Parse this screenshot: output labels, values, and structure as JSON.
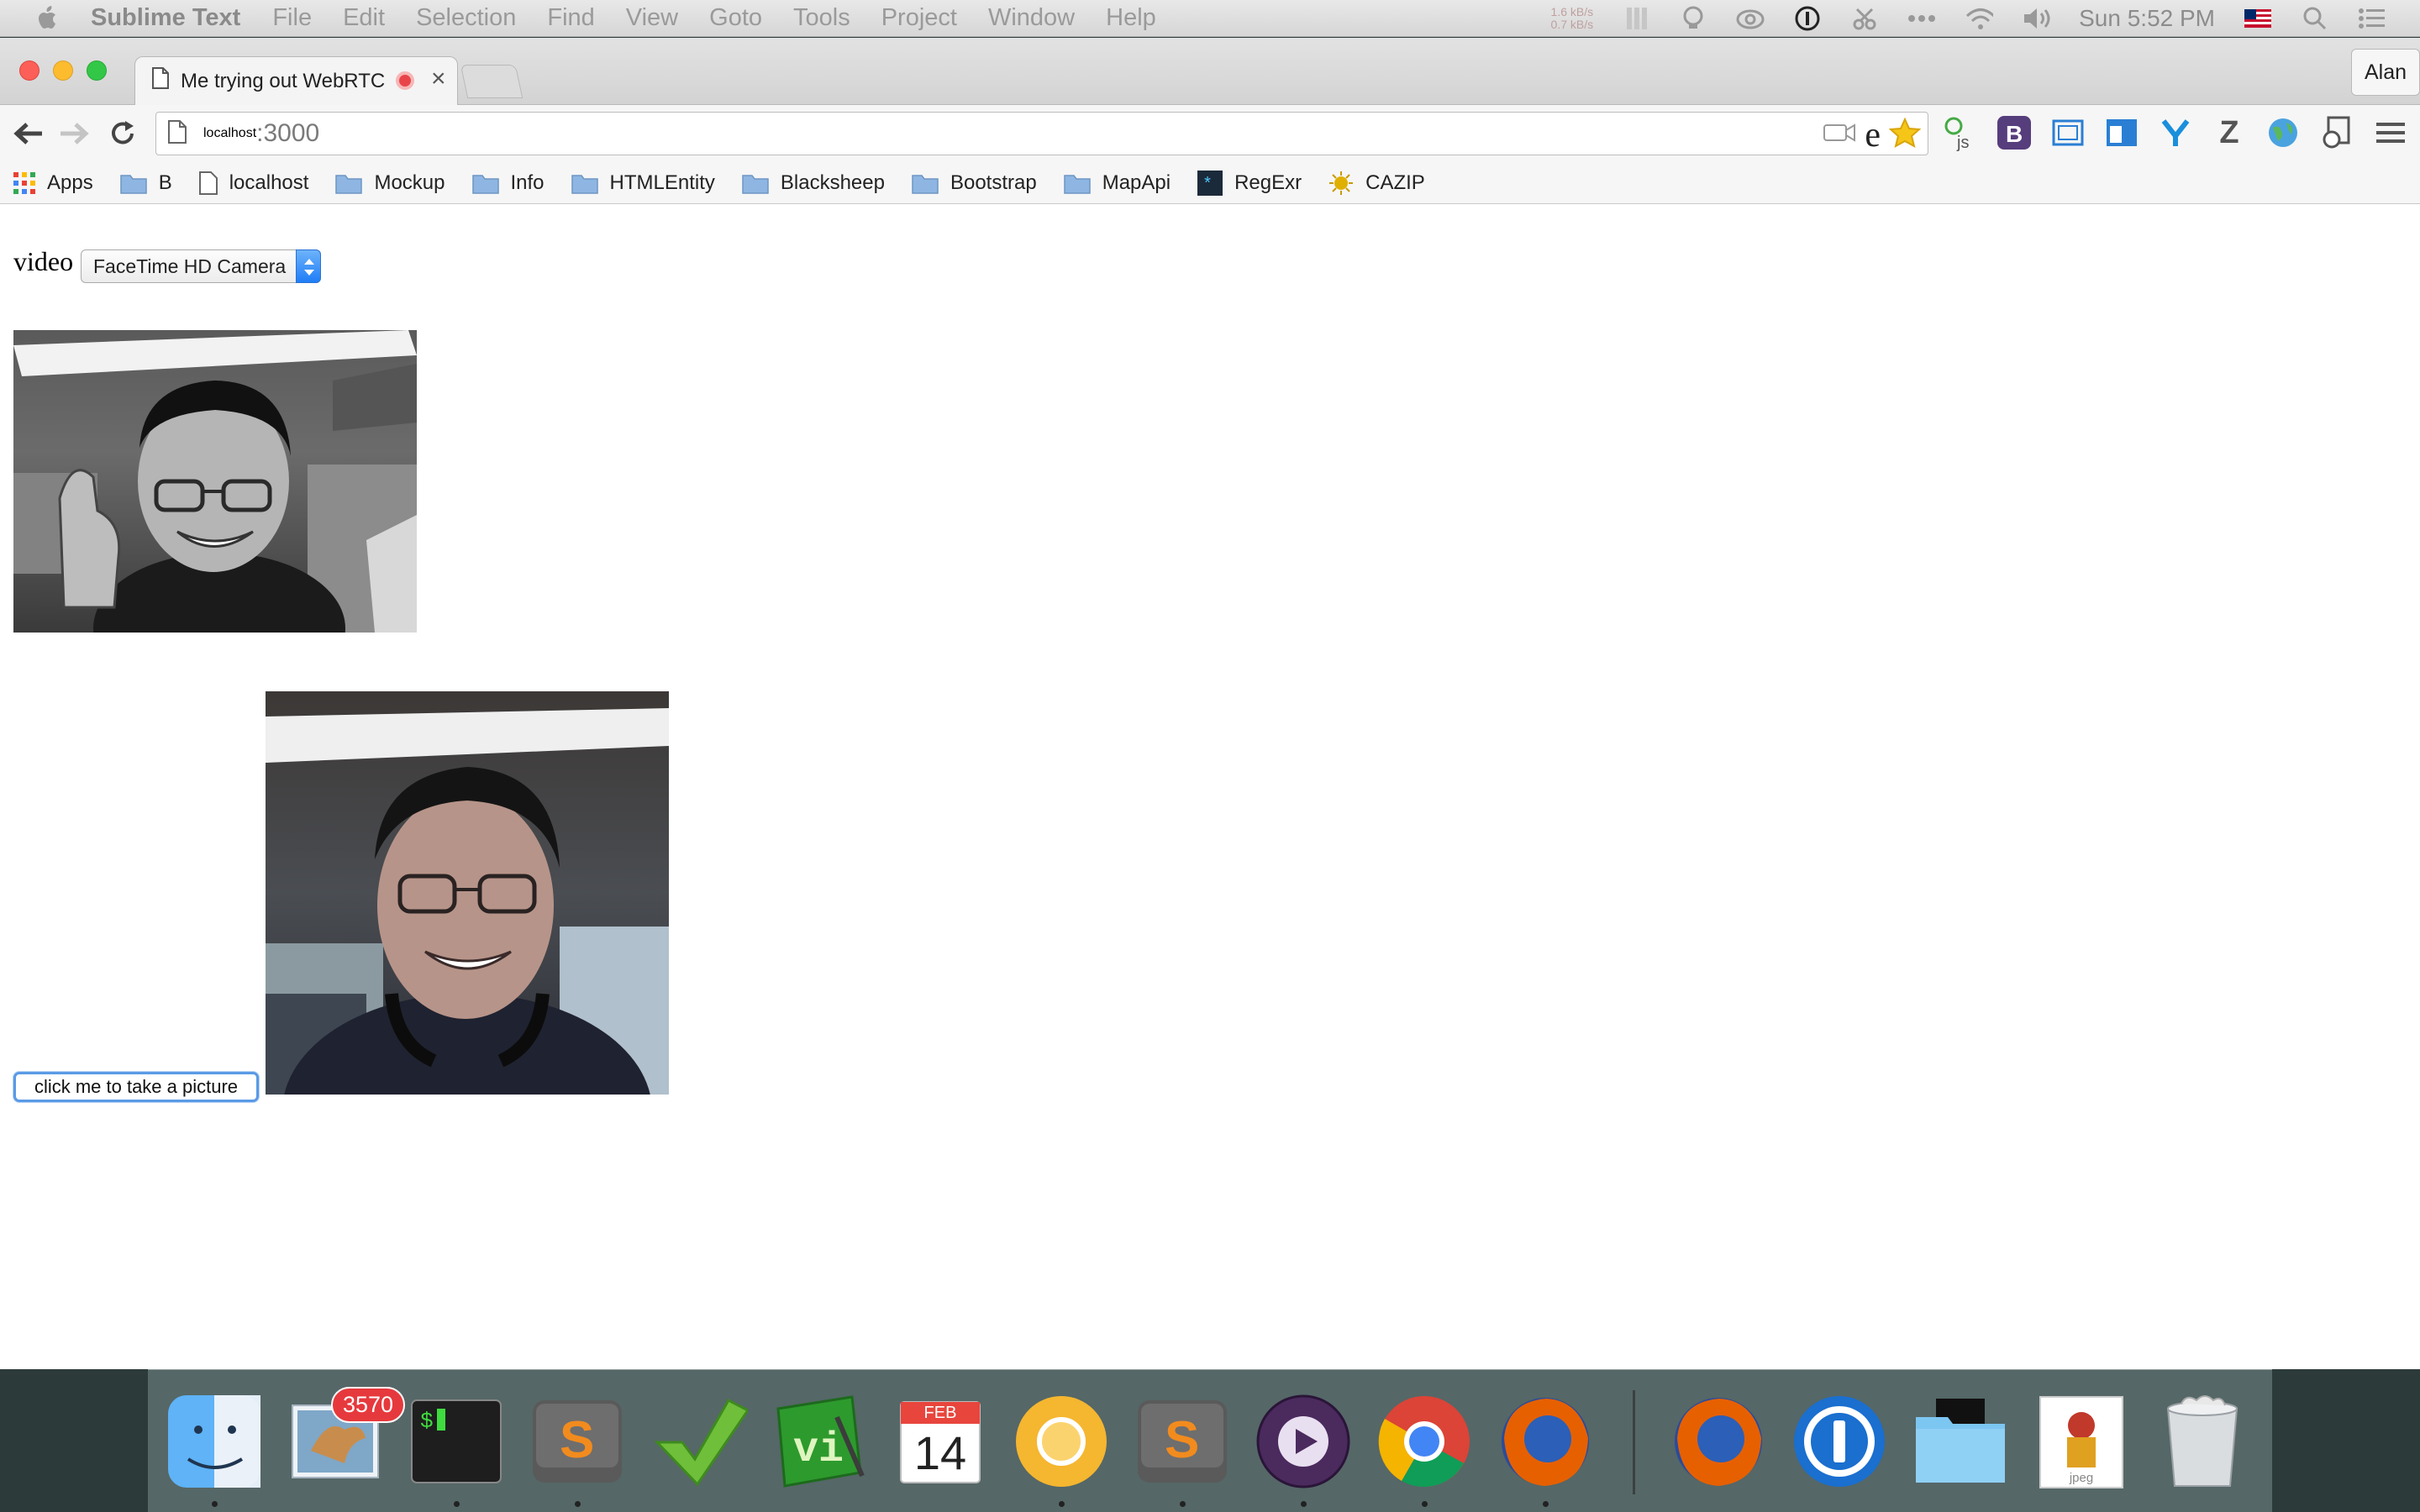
{
  "menubar": {
    "app_name": "Sublime Text",
    "menus": [
      "File",
      "Edit",
      "Selection",
      "Find",
      "View",
      "Goto",
      "Tools",
      "Project",
      "Window",
      "Help"
    ],
    "net_up": "1.6 kB/s",
    "net_down": "0.7 kB/s",
    "clock": "Sun 5:52 PM"
  },
  "browser": {
    "tab_title": "Me trying out WebRTC",
    "profile_name": "Alan",
    "url_host": "localhost",
    "url_port": ":3000",
    "bookmarks": [
      {
        "label": "Apps",
        "icon": "apps-grid-icon"
      },
      {
        "label": "B",
        "icon": "folder-icon"
      },
      {
        "label": "localhost",
        "icon": "page-icon"
      },
      {
        "label": "Mockup",
        "icon": "folder-icon"
      },
      {
        "label": "Info",
        "icon": "folder-icon"
      },
      {
        "label": "HTMLEntity",
        "icon": "folder-icon"
      },
      {
        "label": "Blacksheep",
        "icon": "folder-icon"
      },
      {
        "label": "Bootstrap",
        "icon": "folder-icon"
      },
      {
        "label": "MapApi",
        "icon": "folder-icon"
      },
      {
        "label": "RegExr",
        "icon": "regexr-icon"
      },
      {
        "label": "CAZIP",
        "icon": "sun-icon"
      }
    ]
  },
  "page": {
    "video_label": "video",
    "camera_selected": "FaceTime HD Camera",
    "capture_button": "click me to take a picture"
  },
  "dock": {
    "mail_badge": "3570",
    "calendar_month": "FEB",
    "calendar_day": "14",
    "preview_file_label": "jpeg"
  },
  "colors": {
    "accent_blue": "#1f7ef6",
    "close_red": "#fc5f57",
    "minimize_yellow": "#fdbc2e",
    "maximize_green": "#33c748",
    "badge_red": "#e6393d"
  }
}
